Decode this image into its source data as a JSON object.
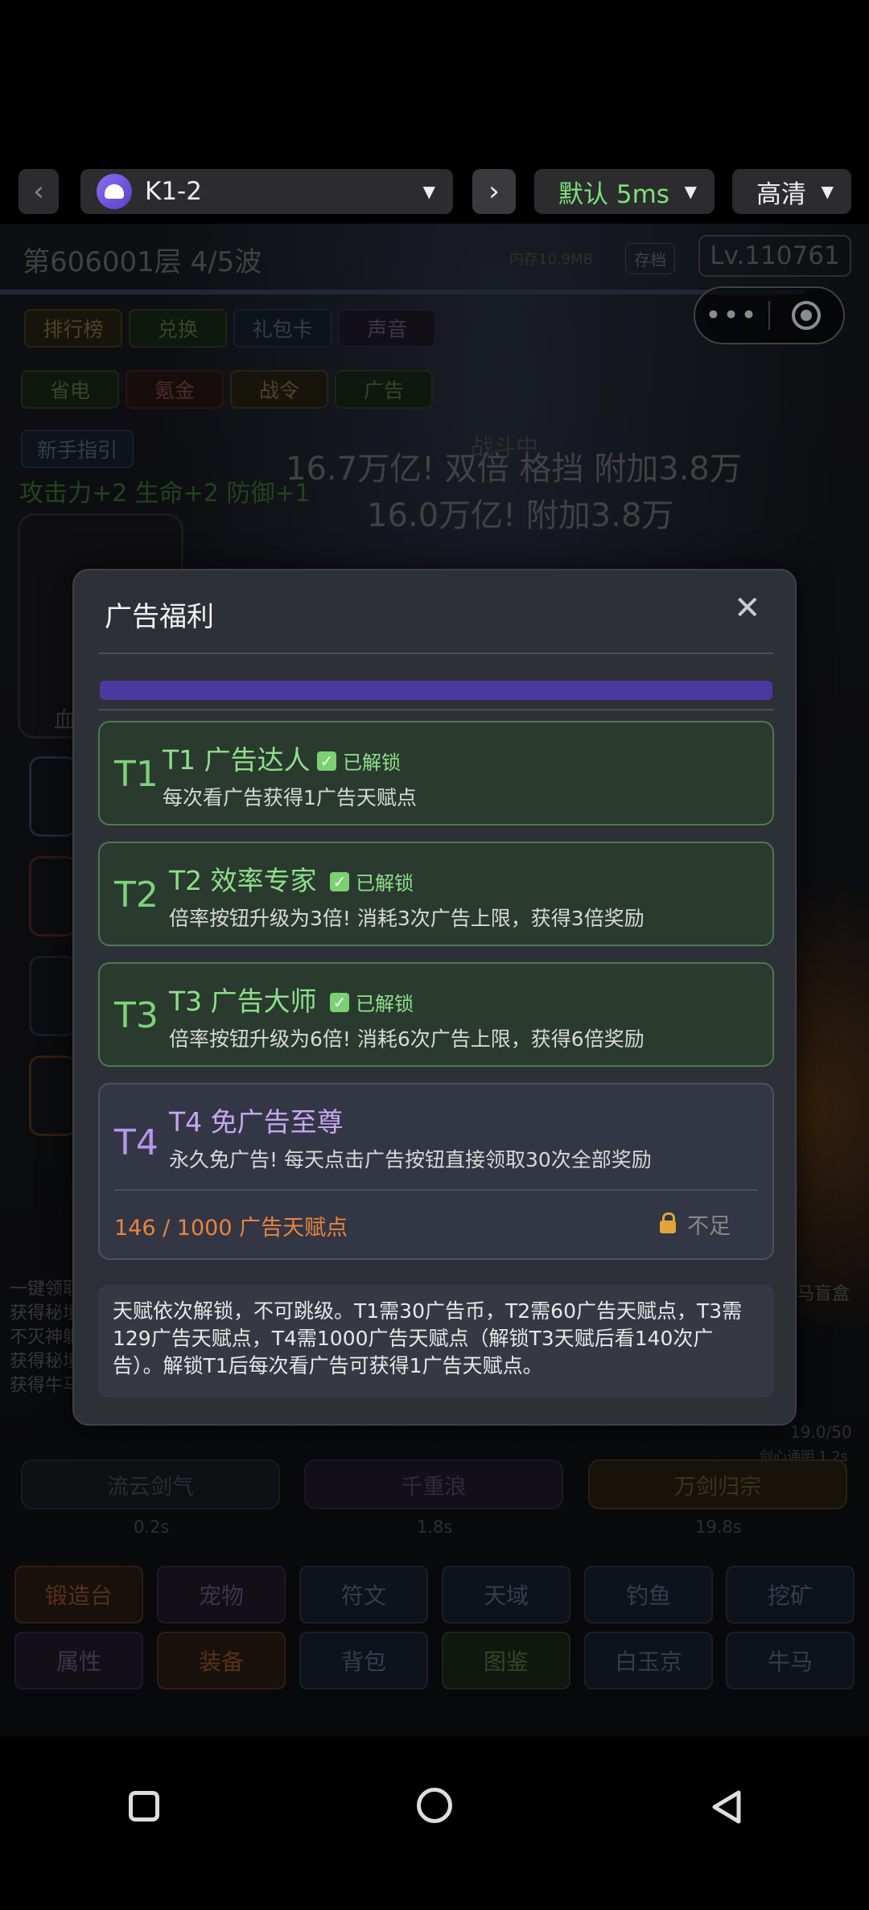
{
  "toolbar": {
    "back_glyph": "‹",
    "app_name": "K1-2",
    "forward_glyph": "›",
    "speed": "默认 5ms",
    "quality": "高清",
    "caret": "▼"
  },
  "game": {
    "stage": "第606001层  4/5波",
    "memory": "内存10.9MB",
    "save": "存档",
    "level": "Lv.110761",
    "row1": [
      "排行榜",
      "兑换",
      "礼包卡",
      "声音"
    ],
    "row2": [
      "省电",
      "氪金",
      "战令",
      "广告"
    ],
    "guide": "新手指引",
    "buff": "攻击力+2 生命+2 防御+1",
    "battle_tag": "战斗中",
    "combat1": "16.7万亿! 双倍 格挡 附加3.8万",
    "combat2": "16.0万亿! 附加3.8万",
    "log": [
      "一键领取",
      "获得秘境",
      "不灭神躯",
      "获得秘境",
      "获得牛马"
    ],
    "log_right": "马盲盒",
    "skill_bar": "19.0/50",
    "skill_sub": "剑心通明 1.2s",
    "skills": [
      {
        "name": "流云剑气",
        "time": "0.2s"
      },
      {
        "name": "千重浪",
        "time": "1.8s"
      },
      {
        "name": "万剑归宗",
        "time": "19.8s"
      }
    ],
    "bottom1": [
      "锻造台",
      "宠物",
      "符文",
      "天域",
      "钓鱼",
      "挖矿"
    ],
    "bottom2": [
      "属性",
      "装备",
      "背包",
      "图鉴",
      "白玉京",
      "牛马"
    ],
    "portrait_label": "血"
  },
  "modal": {
    "title": "广告福利",
    "close": "✕",
    "tiers": [
      {
        "num": "T1",
        "name": "T1 广告达人",
        "badge": "已解锁",
        "desc": "每次看广告获得1广告天赋点"
      },
      {
        "num": "T2",
        "name": "T2 效率专家",
        "badge": "已解锁",
        "desc": "倍率按钮升级为3倍! 消耗3次广告上限，获得3倍奖励"
      },
      {
        "num": "T3",
        "name": "T3 广告大师",
        "badge": "已解锁",
        "desc": "倍率按钮升级为6倍! 消耗6次广告上限，获得6倍奖励"
      }
    ],
    "t4": {
      "num": "T4",
      "name": "T4 免广告至尊",
      "desc": "永久免广告! 每天点击广告按钮直接领取30次全部奖励",
      "progress": "146 / 1000 广告天赋点",
      "need": "不足"
    },
    "note": "天赋依次解锁，不可跳级。T1需30广告币，T2需60广告天赋点，T3需129广告天赋点，T4需1000广告天赋点（解锁T3天赋后看140次广告）。解锁T1后每次看广告可获得1广告天赋点。"
  }
}
